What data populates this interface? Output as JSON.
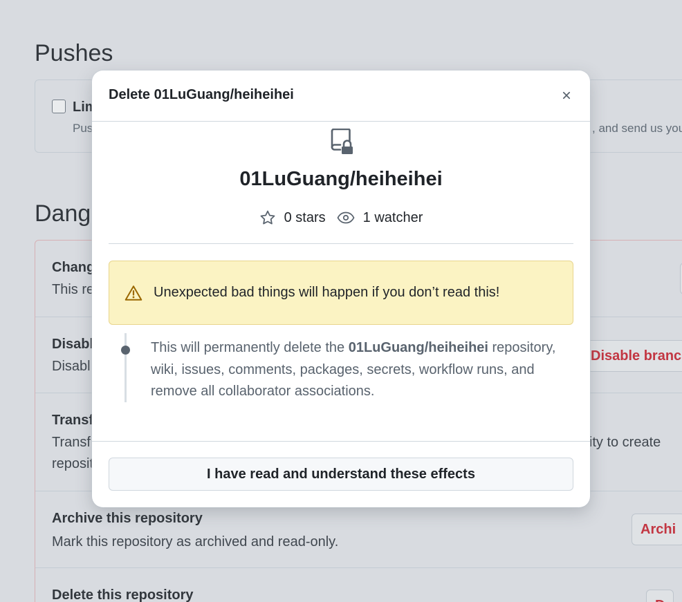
{
  "background": {
    "pushes_heading": "Pushes",
    "pushes_option_label": "Lim",
    "pushes_option_desc_left": "Pus",
    "pushes_option_desc_right": ", and send us you",
    "danger_heading": "Dang",
    "rows": [
      {
        "title": "Chang",
        "desc": "This re",
        "button": ""
      },
      {
        "title": "Disabl",
        "desc": "Disabl",
        "button": "Disable branc"
      },
      {
        "title": "Transf",
        "desc_line1_left": "Transf",
        "desc_line1_right": "ility to create",
        "desc_line2": "reposit",
        "button": ""
      },
      {
        "title": "Archive this repository",
        "desc": "Mark this repository as archived and read-only.",
        "button": "Archi"
      },
      {
        "title": "Delete this repository",
        "desc": "",
        "button": "D"
      }
    ]
  },
  "dialog": {
    "title": "Delete 01LuGuang/heiheihei",
    "close_icon": "x-icon",
    "repo_icon": "repo-locked-icon",
    "repo_name": "01LuGuang/heiheihei",
    "stars": "0 stars",
    "watchers": "1 watcher",
    "warning": "Unexpected bad things will happen if you don’t read this!",
    "effect_prefix": "This will permanently delete the ",
    "effect_repo": "01LuGuang/heiheihei",
    "effect_suffix": " repository, wiki, issues, comments, packages, secrets, workflow runs, and remove all collaborator associations.",
    "confirm_button": "I have read and understand these effects"
  },
  "colors": {
    "danger": "#cf222e",
    "warning_bg": "#fbf3c3",
    "warning_icon": "#9a6700"
  }
}
